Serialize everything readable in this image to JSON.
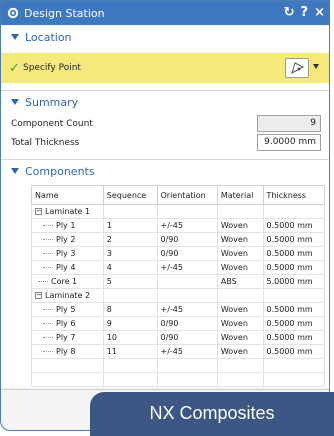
{
  "window": {
    "title": "Design Station",
    "reset_icon": "↻",
    "help_label": "?",
    "close_label": "×"
  },
  "location": {
    "heading": "Location",
    "point_label": "Specify Point",
    "check_icon": "check-icon",
    "point_button_icon": "point-dialog-icon"
  },
  "summary": {
    "heading": "Summary",
    "component_count_label": "Component Count",
    "component_count_value": "9",
    "total_thickness_label": "Total Thickness",
    "total_thickness_value": "9.0000 mm"
  },
  "components": {
    "heading": "Components",
    "columns": [
      "Name",
      "Sequence",
      "Orientation",
      "Material",
      "Thickness"
    ],
    "rows": [
      {
        "name": "Laminate 1",
        "level": 0,
        "expander": "−",
        "sequence": "",
        "orientation": "",
        "material": "",
        "thickness": ""
      },
      {
        "name": "Ply 1",
        "level": 1,
        "sequence": "1",
        "orientation": "+/-45",
        "material": "Woven",
        "thickness": "0.5000 mm"
      },
      {
        "name": "Ply 2",
        "level": 1,
        "sequence": "2",
        "orientation": "0/90",
        "material": "Woven",
        "thickness": "0.5000 mm"
      },
      {
        "name": "Ply 3",
        "level": 1,
        "sequence": "3",
        "orientation": "0/90",
        "material": "Woven",
        "thickness": "0.5000 mm"
      },
      {
        "name": "Ply 4",
        "level": 1,
        "sequence": "4",
        "orientation": "+/-45",
        "material": "Woven",
        "thickness": "0.5000 mm"
      },
      {
        "name": "Core 1",
        "level": 0,
        "sequence": "5",
        "orientation": "",
        "material": "ABS",
        "thickness": "5.0000 mm"
      },
      {
        "name": "Laminate 2",
        "level": 0,
        "expander": "−",
        "sequence": "",
        "orientation": "",
        "material": "",
        "thickness": ""
      },
      {
        "name": "Ply 5",
        "level": 1,
        "sequence": "8",
        "orientation": "+/-45",
        "material": "Woven",
        "thickness": "0.5000 mm"
      },
      {
        "name": "Ply 6",
        "level": 1,
        "sequence": "9",
        "orientation": "0/90",
        "material": "Woven",
        "thickness": "0.5000 mm"
      },
      {
        "name": "Ply 7",
        "level": 1,
        "sequence": "10",
        "orientation": "0/90",
        "material": "Woven",
        "thickness": "0.5000 mm"
      },
      {
        "name": "Ply 8",
        "level": 1,
        "sequence": "11",
        "orientation": "+/-45",
        "material": "Woven",
        "thickness": "0.5000 mm"
      }
    ]
  },
  "banner": {
    "text": "NX Composites"
  },
  "colors": {
    "titlebar": "#3e78c1",
    "accent": "#2f66ac",
    "highlight": "#f5e97b",
    "banner": "#3d5785"
  }
}
